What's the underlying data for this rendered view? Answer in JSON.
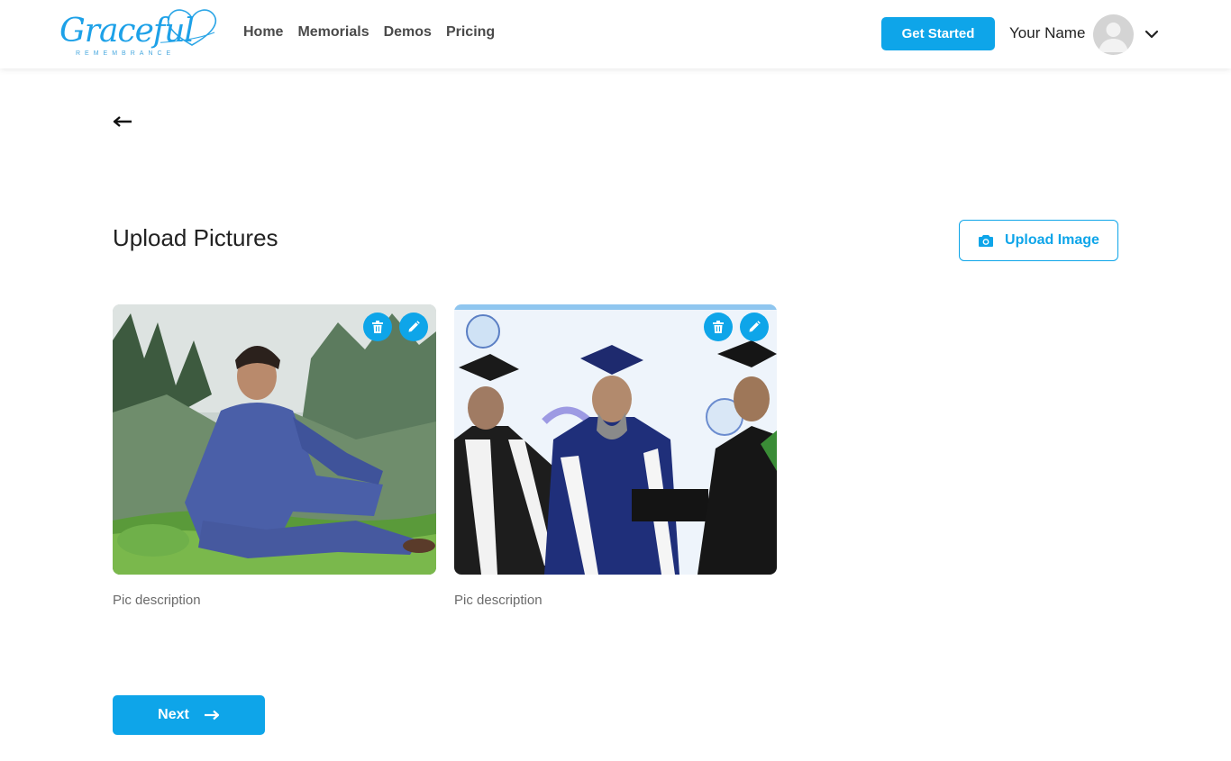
{
  "brand": {
    "logo_text": "Graceful",
    "logo_subtext": "REMEMBRANCE",
    "accent_color": "#0ea5e9"
  },
  "nav": {
    "items": [
      {
        "label": "Home"
      },
      {
        "label": "Memorials"
      },
      {
        "label": "Demos"
      },
      {
        "label": "Pricing"
      }
    ]
  },
  "header": {
    "cta_label": "Get Started",
    "user_name": "Your Name",
    "avatar_icon": "user-avatar-icon",
    "menu_icon": "chevron-down-icon"
  },
  "main": {
    "back_icon": "arrow-left-icon",
    "title": "Upload Pictures",
    "upload_button_label": "Upload Image",
    "upload_icon": "camera-icon",
    "pictures": [
      {
        "description": "Pic description",
        "delete_icon": "trash-icon",
        "edit_icon": "pencil-icon"
      },
      {
        "description": "Pic description",
        "delete_icon": "trash-icon",
        "edit_icon": "pencil-icon"
      }
    ],
    "next_button_label": "Next",
    "next_icon": "arrow-right-icon"
  }
}
